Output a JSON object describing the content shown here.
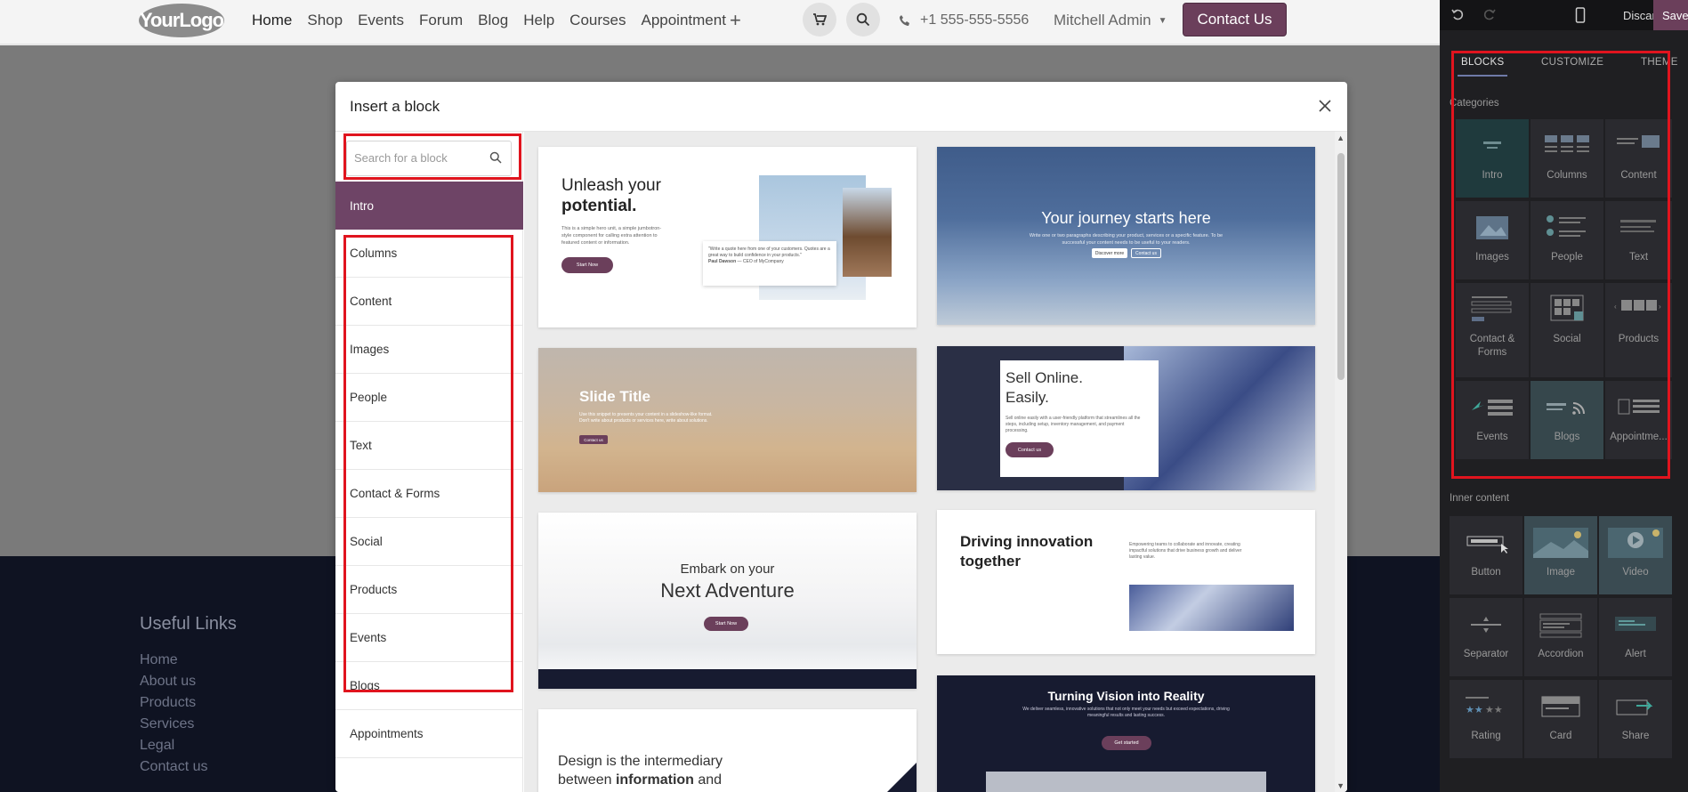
{
  "site": {
    "logo_text": "YourLogo",
    "nav": [
      "Home",
      "Shop",
      "Events",
      "Forum",
      "Blog",
      "Help",
      "Courses",
      "Appointment"
    ],
    "nav_add": "+",
    "phone": "+1 555-555-5556",
    "user": "Mitchell Admin",
    "contact_button": "Contact Us",
    "footer": {
      "title": "Useful Links",
      "links": [
        "Home",
        "About us",
        "Products",
        "Services",
        "Legal",
        "Contact us"
      ]
    }
  },
  "modal": {
    "title": "Insert a block",
    "search_placeholder": "Search for a block",
    "categories": [
      "Intro",
      "Columns",
      "Content",
      "Images",
      "People",
      "Text",
      "Contact & Forms",
      "Social",
      "Products",
      "Events",
      "Blogs",
      "Appointments"
    ],
    "active_category": "Intro",
    "previews": {
      "card1": {
        "title_line1": "Unleash your",
        "title_line2": "potential.",
        "text": "This is a simple hero unit, a simple jumbotron-style component for calling extra attention to featured content or information.",
        "button": "Start Now",
        "quote": "\"Write a quote here from one of your customers. Quotes are a great way to build confidence in your products.\"",
        "author": "Paul Dawson",
        "author_role": "CEO of MyCompany"
      },
      "card2": {
        "title": "Your journey starts here",
        "text": "Write one or two paragraphs describing your product, services or a specific feature. To be successful your content needs to be useful to your readers.",
        "button1": "Discover more",
        "button2": "Contact us"
      },
      "card3": {
        "title": "Slide Title",
        "text": "Use this snippet to presents your content in a slideshow-like format. Don't write about products or services here, write about solutions.",
        "button": "Contact us"
      },
      "card4": {
        "title_line1": "Sell Online.",
        "title_line2": "Easily.",
        "text": "Sell online easily with a user-friendly platform that streamlines all the steps, including setup, inventory management, and payment processing.",
        "button": "Contact us"
      },
      "card5": {
        "subtitle": "Embark on your",
        "title": "Next Adventure",
        "button": "Start Now"
      },
      "card6": {
        "title_line1": "Driving innovation",
        "title_line2": "together",
        "text": "Empowering teams to collaborate and innovate, creating impactful solutions that drive business growth and deliver lasting value."
      },
      "card7": {
        "title": "Turning Vision into Reality",
        "text": "We deliver seamless, innovative solutions that not only meet your needs but exceed expectations, driving meaningful results and lasting success.",
        "button": "Get started"
      },
      "card8": {
        "title_line1": "Design is the intermediary",
        "title_line2_a": "between ",
        "title_line2_b": "information",
        "title_line2_c": " and"
      }
    }
  },
  "editor": {
    "discard": "Discard",
    "save": "Save",
    "tabs": [
      "BLOCKS",
      "CUSTOMIZE",
      "THEME"
    ],
    "categories_title": "Categories",
    "categories": [
      "Intro",
      "Columns",
      "Content",
      "Images",
      "People",
      "Text",
      "Contact & Forms",
      "Social",
      "Products",
      "Events",
      "Blogs",
      "Appointme..."
    ],
    "inner_title": "Inner content",
    "inner": [
      "Button",
      "Image",
      "Video",
      "Separator",
      "Accordion",
      "Alert",
      "Rating",
      "Card",
      "Share"
    ]
  },
  "colors": {
    "primary": "#6b3f5b",
    "highlight": "#e0141e",
    "footer_bg": "#0f1322",
    "editor_bg": "#1f1f22"
  }
}
